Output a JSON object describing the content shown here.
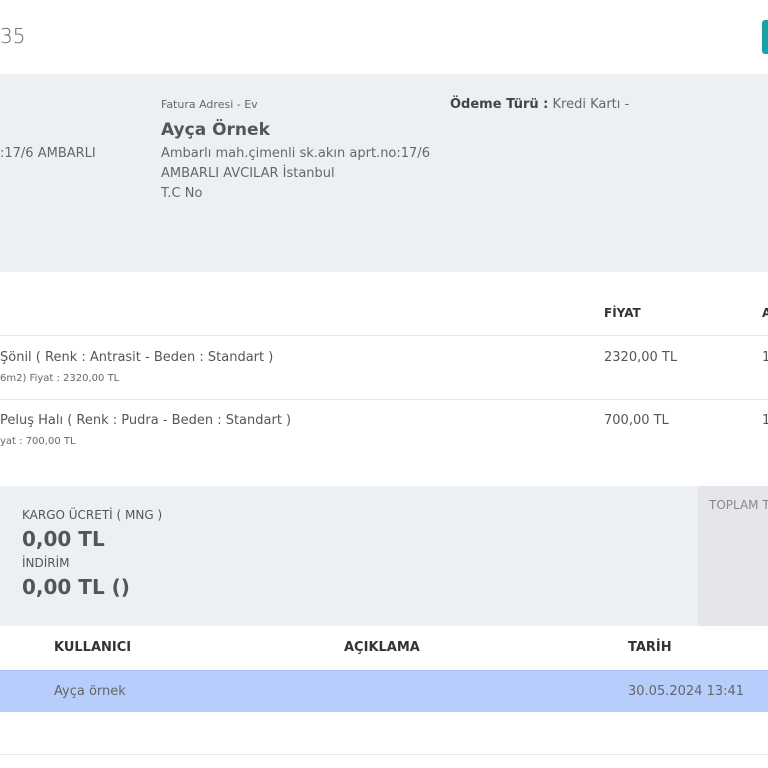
{
  "header": {
    "order_number_fragment": "35"
  },
  "shipping_address": {
    "line_fragment": ":17/6 AMBARLI"
  },
  "billing_address": {
    "label": "Fatura Adresi - Ev",
    "name": "Ayça Örnek",
    "line1": "Ambarlı mah.çimenli sk.akın aprt.no:17/6",
    "line2": "AMBARLI AVCILAR İstanbul",
    "line3": "T.C No"
  },
  "payment": {
    "label": "Ödeme Türü :",
    "value": "Kredi Kartı -"
  },
  "products": {
    "headers": {
      "price": "FİYAT",
      "qty": "A"
    },
    "items": [
      {
        "name": "Şönil ( Renk : Antrasit - Beden : Standart )",
        "sub": "6m2) Fiyat : 2320,00 TL",
        "price": "2320,00 TL",
        "qty": "1"
      },
      {
        "name": "Peluş Halı ( Renk : Pudra - Beden : Standart )",
        "sub": "yat : 700,00 TL",
        "price": "700,00 TL",
        "qty": "1"
      }
    ]
  },
  "totals": {
    "shipping_label": "KARGO ÜCRETİ ( MNG )",
    "shipping_value": "0,00 TL",
    "discount_label": "İNDİRİM",
    "discount_value": "0,00 TL ()",
    "total_label": "TOPLAM T"
  },
  "history": {
    "headers": {
      "user": "KULLANICI",
      "description": "AÇIKLAMA",
      "date": "TARİH"
    },
    "rows": [
      {
        "user": "Ayça örnek",
        "description": "",
        "date": "30.05.2024 13:41"
      }
    ]
  },
  "colors": {
    "accent_teal": "#17a2a8",
    "row_highlight": "#b7cdfb",
    "panel_bg": "#edf0f3"
  }
}
